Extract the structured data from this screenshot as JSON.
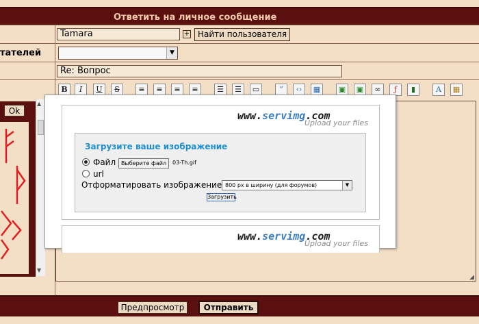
{
  "header": {
    "title": "Ответить на личное сообщение"
  },
  "form": {
    "recipient_value": "Tamara",
    "add_icon": "+",
    "find_user_label": "Найти пользователя",
    "users_label": "тателей",
    "subject_value": "Re: Вопрос",
    "ok_label": "Ok"
  },
  "toolbar": {
    "bold": "B",
    "italic": "I",
    "underline": "U",
    "strike": "S"
  },
  "popup": {
    "logo_prefix": "www.",
    "logo_main": "servimg",
    "logo_suffix": ".com",
    "slogan": "Upload your files",
    "upload_title": "Загрузите ваше изображение",
    "file_option": "Файл",
    "choose_file": "Выберите файл",
    "file_name": "03-Th.gif",
    "url_option": "url",
    "format_label": "Отформатировать изображение",
    "format_selected": "800 px в ширину (для форумов)",
    "upload_button": "Загрузить"
  },
  "footer": {
    "preview_label": "Предпросмотр",
    "send_label": "Отправить"
  },
  "colors": {
    "frame": "#5b1010",
    "cell": "#f3dfc6",
    "accent": "#1e8fd0",
    "logo_blue": "#3b7dc4"
  }
}
